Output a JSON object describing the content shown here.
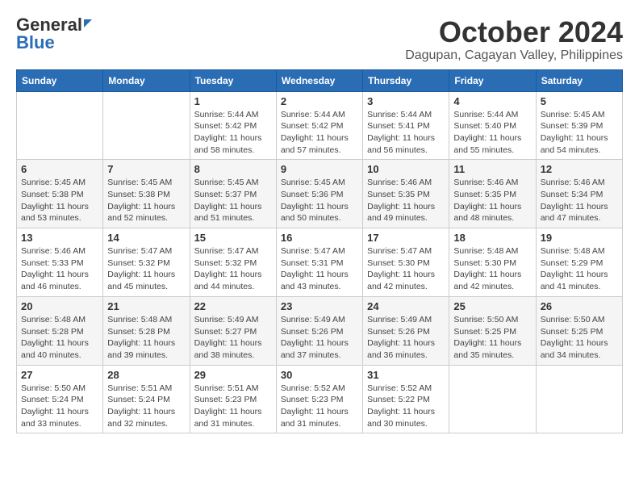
{
  "logo": {
    "general": "General",
    "blue": "Blue"
  },
  "title": "October 2024",
  "location": "Dagupan, Cagayan Valley, Philippines",
  "days_of_week": [
    "Sunday",
    "Monday",
    "Tuesday",
    "Wednesday",
    "Thursday",
    "Friday",
    "Saturday"
  ],
  "weeks": [
    [
      {
        "day": "",
        "sunrise": "",
        "sunset": "",
        "daylight": ""
      },
      {
        "day": "",
        "sunrise": "",
        "sunset": "",
        "daylight": ""
      },
      {
        "day": "1",
        "sunrise": "Sunrise: 5:44 AM",
        "sunset": "Sunset: 5:42 PM",
        "daylight": "Daylight: 11 hours and 58 minutes."
      },
      {
        "day": "2",
        "sunrise": "Sunrise: 5:44 AM",
        "sunset": "Sunset: 5:42 PM",
        "daylight": "Daylight: 11 hours and 57 minutes."
      },
      {
        "day": "3",
        "sunrise": "Sunrise: 5:44 AM",
        "sunset": "Sunset: 5:41 PM",
        "daylight": "Daylight: 11 hours and 56 minutes."
      },
      {
        "day": "4",
        "sunrise": "Sunrise: 5:44 AM",
        "sunset": "Sunset: 5:40 PM",
        "daylight": "Daylight: 11 hours and 55 minutes."
      },
      {
        "day": "5",
        "sunrise": "Sunrise: 5:45 AM",
        "sunset": "Sunset: 5:39 PM",
        "daylight": "Daylight: 11 hours and 54 minutes."
      }
    ],
    [
      {
        "day": "6",
        "sunrise": "Sunrise: 5:45 AM",
        "sunset": "Sunset: 5:38 PM",
        "daylight": "Daylight: 11 hours and 53 minutes."
      },
      {
        "day": "7",
        "sunrise": "Sunrise: 5:45 AM",
        "sunset": "Sunset: 5:38 PM",
        "daylight": "Daylight: 11 hours and 52 minutes."
      },
      {
        "day": "8",
        "sunrise": "Sunrise: 5:45 AM",
        "sunset": "Sunset: 5:37 PM",
        "daylight": "Daylight: 11 hours and 51 minutes."
      },
      {
        "day": "9",
        "sunrise": "Sunrise: 5:45 AM",
        "sunset": "Sunset: 5:36 PM",
        "daylight": "Daylight: 11 hours and 50 minutes."
      },
      {
        "day": "10",
        "sunrise": "Sunrise: 5:46 AM",
        "sunset": "Sunset: 5:35 PM",
        "daylight": "Daylight: 11 hours and 49 minutes."
      },
      {
        "day": "11",
        "sunrise": "Sunrise: 5:46 AM",
        "sunset": "Sunset: 5:35 PM",
        "daylight": "Daylight: 11 hours and 48 minutes."
      },
      {
        "day": "12",
        "sunrise": "Sunrise: 5:46 AM",
        "sunset": "Sunset: 5:34 PM",
        "daylight": "Daylight: 11 hours and 47 minutes."
      }
    ],
    [
      {
        "day": "13",
        "sunrise": "Sunrise: 5:46 AM",
        "sunset": "Sunset: 5:33 PM",
        "daylight": "Daylight: 11 hours and 46 minutes."
      },
      {
        "day": "14",
        "sunrise": "Sunrise: 5:47 AM",
        "sunset": "Sunset: 5:32 PM",
        "daylight": "Daylight: 11 hours and 45 minutes."
      },
      {
        "day": "15",
        "sunrise": "Sunrise: 5:47 AM",
        "sunset": "Sunset: 5:32 PM",
        "daylight": "Daylight: 11 hours and 44 minutes."
      },
      {
        "day": "16",
        "sunrise": "Sunrise: 5:47 AM",
        "sunset": "Sunset: 5:31 PM",
        "daylight": "Daylight: 11 hours and 43 minutes."
      },
      {
        "day": "17",
        "sunrise": "Sunrise: 5:47 AM",
        "sunset": "Sunset: 5:30 PM",
        "daylight": "Daylight: 11 hours and 42 minutes."
      },
      {
        "day": "18",
        "sunrise": "Sunrise: 5:48 AM",
        "sunset": "Sunset: 5:30 PM",
        "daylight": "Daylight: 11 hours and 42 minutes."
      },
      {
        "day": "19",
        "sunrise": "Sunrise: 5:48 AM",
        "sunset": "Sunset: 5:29 PM",
        "daylight": "Daylight: 11 hours and 41 minutes."
      }
    ],
    [
      {
        "day": "20",
        "sunrise": "Sunrise: 5:48 AM",
        "sunset": "Sunset: 5:28 PM",
        "daylight": "Daylight: 11 hours and 40 minutes."
      },
      {
        "day": "21",
        "sunrise": "Sunrise: 5:48 AM",
        "sunset": "Sunset: 5:28 PM",
        "daylight": "Daylight: 11 hours and 39 minutes."
      },
      {
        "day": "22",
        "sunrise": "Sunrise: 5:49 AM",
        "sunset": "Sunset: 5:27 PM",
        "daylight": "Daylight: 11 hours and 38 minutes."
      },
      {
        "day": "23",
        "sunrise": "Sunrise: 5:49 AM",
        "sunset": "Sunset: 5:26 PM",
        "daylight": "Daylight: 11 hours and 37 minutes."
      },
      {
        "day": "24",
        "sunrise": "Sunrise: 5:49 AM",
        "sunset": "Sunset: 5:26 PM",
        "daylight": "Daylight: 11 hours and 36 minutes."
      },
      {
        "day": "25",
        "sunrise": "Sunrise: 5:50 AM",
        "sunset": "Sunset: 5:25 PM",
        "daylight": "Daylight: 11 hours and 35 minutes."
      },
      {
        "day": "26",
        "sunrise": "Sunrise: 5:50 AM",
        "sunset": "Sunset: 5:25 PM",
        "daylight": "Daylight: 11 hours and 34 minutes."
      }
    ],
    [
      {
        "day": "27",
        "sunrise": "Sunrise: 5:50 AM",
        "sunset": "Sunset: 5:24 PM",
        "daylight": "Daylight: 11 hours and 33 minutes."
      },
      {
        "day": "28",
        "sunrise": "Sunrise: 5:51 AM",
        "sunset": "Sunset: 5:24 PM",
        "daylight": "Daylight: 11 hours and 32 minutes."
      },
      {
        "day": "29",
        "sunrise": "Sunrise: 5:51 AM",
        "sunset": "Sunset: 5:23 PM",
        "daylight": "Daylight: 11 hours and 31 minutes."
      },
      {
        "day": "30",
        "sunrise": "Sunrise: 5:52 AM",
        "sunset": "Sunset: 5:23 PM",
        "daylight": "Daylight: 11 hours and 31 minutes."
      },
      {
        "day": "31",
        "sunrise": "Sunrise: 5:52 AM",
        "sunset": "Sunset: 5:22 PM",
        "daylight": "Daylight: 11 hours and 30 minutes."
      },
      {
        "day": "",
        "sunrise": "",
        "sunset": "",
        "daylight": ""
      },
      {
        "day": "",
        "sunrise": "",
        "sunset": "",
        "daylight": ""
      }
    ]
  ]
}
